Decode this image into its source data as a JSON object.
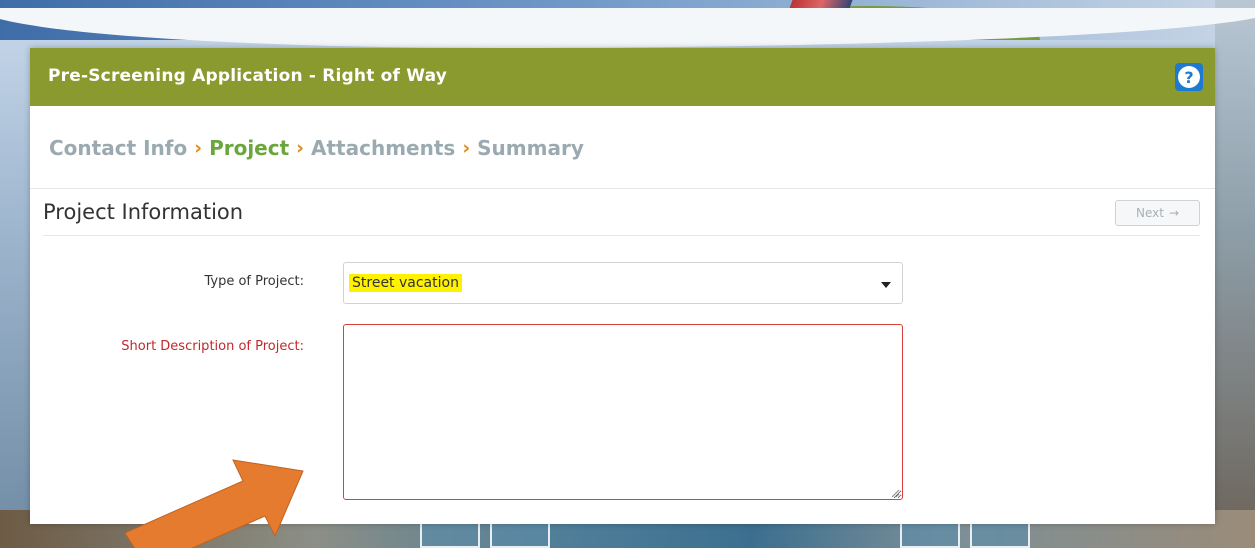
{
  "header": {
    "title": "Pre-Screening Application - Right of Way",
    "help_icon": "question-circle-icon",
    "help_glyph": "?"
  },
  "steps": [
    {
      "label": "Contact Info",
      "active": false
    },
    {
      "label": "Project",
      "active": true
    },
    {
      "label": "Attachments",
      "active": false
    },
    {
      "label": "Summary",
      "active": false
    }
  ],
  "step_separator": "›",
  "section": {
    "title": "Project Information",
    "next_label": "Next",
    "next_icon": "arrow-right-icon",
    "next_glyph": "→"
  },
  "form": {
    "type_label": "Type of Project:",
    "type_value": "Street vacation",
    "desc_label": "Short Description of Project:",
    "desc_value": ""
  },
  "colors": {
    "header_bg": "#8a9a2e",
    "active_step": "#6aa63c",
    "inactive_step": "#9aaab0",
    "separator": "#e08a20",
    "required_label": "#c0292b",
    "highlight": "#fff200",
    "annotation_arrow": "#e57b2e"
  }
}
